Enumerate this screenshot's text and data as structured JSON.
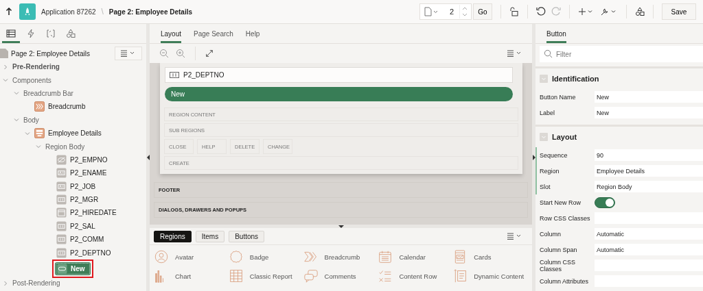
{
  "top_bar": {
    "application": "Application 87262",
    "separator": "\\",
    "page": "Page 2: Employee Details",
    "page_number": "2",
    "go": "Go",
    "save": "Save"
  },
  "left_tabs": [
    {
      "selected": true
    },
    {
      "selected": false
    },
    {
      "selected": false
    },
    {
      "selected": false
    }
  ],
  "tree": {
    "title": "Page 2: Employee Details",
    "nodes": [
      {
        "label": "Pre-Rendering",
        "kind": "section",
        "expanded": false,
        "selected": false
      },
      {
        "label": "Components",
        "kind": "group",
        "expanded": true,
        "selected": false,
        "children": [
          {
            "label": "Breadcrumb Bar",
            "kind": "group",
            "expanded": true,
            "selected": false,
            "children": [
              {
                "label": "Breadcrumb",
                "kind": "breadcrumb",
                "selected": false
              }
            ]
          },
          {
            "label": "Body",
            "kind": "group",
            "expanded": true,
            "selected": false,
            "children": [
              {
                "label": "Employee Details",
                "kind": "region",
                "expanded": true,
                "selected": false,
                "children": [
                  {
                    "label": "Region Body",
                    "kind": "group",
                    "expanded": true,
                    "selected": false,
                    "children": [
                      {
                        "label": "P2_EMPNO",
                        "kind": "hidden-item",
                        "selected": false
                      },
                      {
                        "label": "P2_ENAME",
                        "kind": "text-item",
                        "selected": false
                      },
                      {
                        "label": "P2_JOB",
                        "kind": "text-item",
                        "selected": false
                      },
                      {
                        "label": "P2_MGR",
                        "kind": "number-item",
                        "selected": false
                      },
                      {
                        "label": "P2_HIREDATE",
                        "kind": "date-item",
                        "selected": false
                      },
                      {
                        "label": "P2_SAL",
                        "kind": "number-item",
                        "selected": false
                      },
                      {
                        "label": "P2_COMM",
                        "kind": "number-item",
                        "selected": false
                      },
                      {
                        "label": "P2_DEPTNO",
                        "kind": "number-item",
                        "selected": false
                      },
                      {
                        "label": "New",
                        "kind": "button",
                        "selected": true
                      }
                    ]
                  }
                ]
              }
            ]
          }
        ]
      },
      {
        "label": "Post-Rendering",
        "kind": "group",
        "expanded": false,
        "selected": false
      }
    ]
  },
  "layout_tabs": [
    {
      "label": "Layout",
      "selected": true
    },
    {
      "label": "Page Search",
      "selected": false
    },
    {
      "label": "Help",
      "selected": false
    }
  ],
  "canvas": {
    "item_field": "P2_DEPTNO",
    "button": "New",
    "region_slots": [
      {
        "kind": "row",
        "label": "REGION CONTENT"
      },
      {
        "kind": "row",
        "label": "SUB REGIONS"
      },
      {
        "kind": "buttons",
        "labels": [
          "CLOSE",
          "HELP",
          "DELETE",
          "CHANGE"
        ]
      },
      {
        "kind": "row",
        "label": "CREATE"
      }
    ],
    "page_slots": [
      "FOOTER",
      "DIALOGS, DRAWERS AND POPUPS"
    ]
  },
  "gallery": {
    "tabs": [
      {
        "label": "Regions",
        "selected": true
      },
      {
        "label": "Items",
        "selected": false
      },
      {
        "label": "Buttons",
        "selected": false
      }
    ],
    "items": [
      "Avatar",
      "Badge",
      "Breadcrumb",
      "Calendar",
      "Cards",
      "Chart",
      "Classic Report",
      "Comments",
      "Content Row",
      "Dynamic Content"
    ]
  },
  "property_tabs": [
    {
      "label": "Button",
      "selected": true
    }
  ],
  "filter": {
    "placeholder": "Filter"
  },
  "groups": [
    {
      "title": "Identification",
      "properties": [
        {
          "kind": "text",
          "label": "Button Name",
          "value": "New",
          "required": false
        },
        {
          "kind": "text",
          "label": "Label",
          "value": "New",
          "required": false
        }
      ]
    },
    {
      "title": "Layout",
      "properties": [
        {
          "kind": "text",
          "label": "Sequence",
          "value": "90",
          "required": true
        },
        {
          "kind": "text",
          "label": "Region",
          "value": "Employee Details",
          "required": true
        },
        {
          "kind": "text",
          "label": "Slot",
          "value": "Region Body",
          "required": true
        },
        {
          "kind": "switch",
          "label": "Start New Row",
          "on": true,
          "required": false
        },
        {
          "kind": "text",
          "label": "Row CSS Classes",
          "required": false
        },
        {
          "kind": "text",
          "label": "Column",
          "value": "Automatic",
          "required": false
        },
        {
          "kind": "text",
          "label": "Column Span",
          "value": "Automatic",
          "required": false
        },
        {
          "kind": "text",
          "label": "Column CSS Classes",
          "required": false
        },
        {
          "kind": "text",
          "label": "Column Attributes",
          "required": false
        }
      ]
    }
  ]
}
